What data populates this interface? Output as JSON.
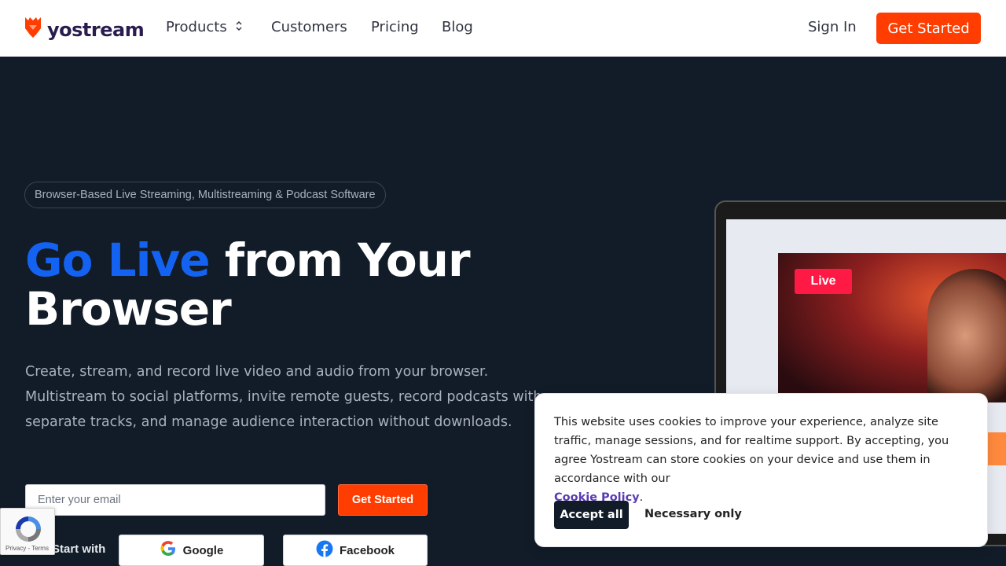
{
  "nav": {
    "logo_text": "yostream",
    "links": [
      "Products",
      "Customers",
      "Pricing",
      "Blog"
    ],
    "sign_in": "Sign In",
    "get_started": "Get Started"
  },
  "hero": {
    "pill": "Browser-Based Live Streaming, Multistreaming & Podcast Software",
    "headline_accent": "Go Live",
    "headline_rest": " from Your Browser",
    "description": "Create, stream, and record live video and audio from your browser. Multistream to social platforms, invite remote guests, record podcasts with separate tracks, and manage audience interaction without downloads.",
    "email_placeholder": "Enter your email",
    "cta": "Get Started",
    "start_with": "Start with",
    "google": "Google",
    "facebook": "Facebook"
  },
  "preview": {
    "live_badge": "Live"
  },
  "cookie": {
    "text": "This website uses cookies to improve your experience, analyze site traffic, manage sessions, and for realtime support. By accepting, you agree Yostream can store cookies on your device and use them in accordance with our",
    "link": "Cookie Policy",
    "period": ".",
    "accept": "Accept all",
    "necessary": "Necessary only"
  },
  "recaptcha": {
    "text": "Privacy - Terms"
  },
  "colors": {
    "accent_orange": "#ff3d00",
    "accent_blue": "#1462f2",
    "hero_bg": "#111c28"
  }
}
